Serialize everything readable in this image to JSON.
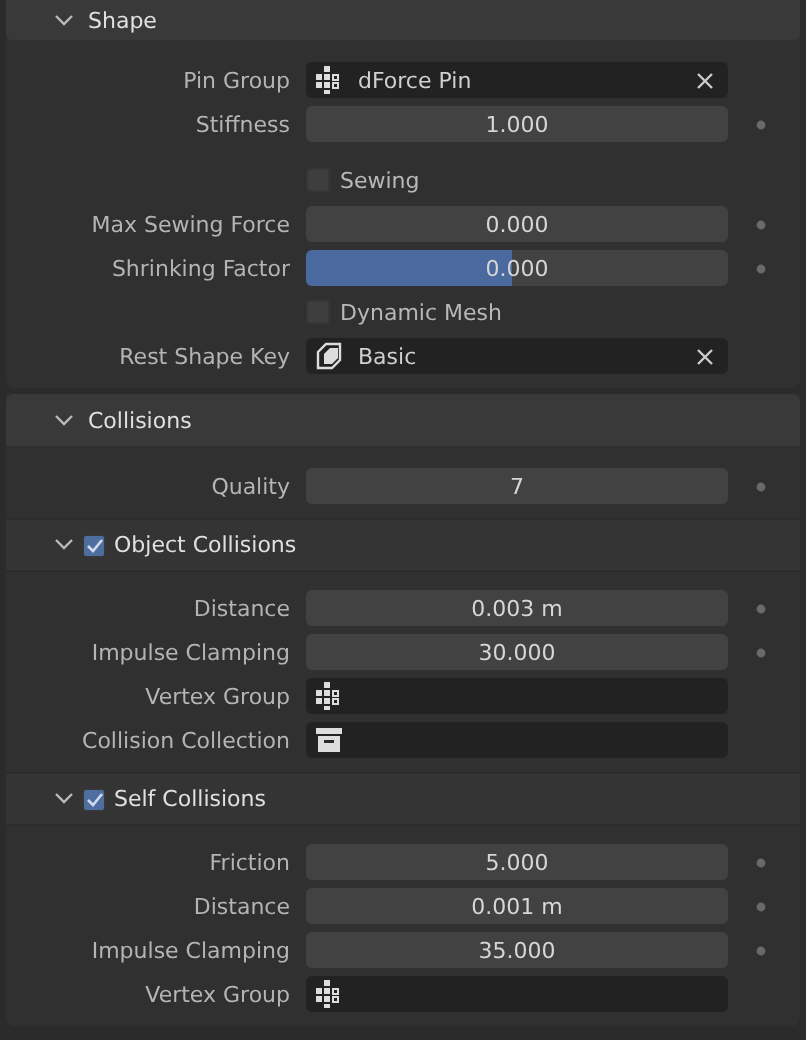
{
  "panels": [
    {
      "title": "Shape",
      "expanded": true,
      "rows": [
        {
          "kind": "vertex_group",
          "label": "Pin Group",
          "value": "dForce Pin"
        },
        {
          "kind": "number",
          "label": "Stiffness",
          "value": "1.000"
        },
        {
          "kind": "spacer"
        },
        {
          "kind": "checkbox",
          "label": "Sewing",
          "checked": false
        },
        {
          "kind": "number",
          "label": "Max Sewing Force",
          "value": "0.000"
        },
        {
          "kind": "slider",
          "label": "Shrinking Factor",
          "value": "0.000",
          "level": 0.49
        },
        {
          "kind": "checkbox",
          "label": "Dynamic Mesh",
          "checked": false
        },
        {
          "kind": "shape_key",
          "label": "Rest Shape Key",
          "value": "Basic"
        }
      ]
    },
    {
      "title": "Collisions",
      "expanded": true,
      "rows": [
        {
          "kind": "number",
          "label": "Quality",
          "value": "7"
        }
      ],
      "subpanels": [
        {
          "title": "Object Collisions",
          "expanded": true,
          "checked": true,
          "rows": [
            {
              "kind": "number",
              "label": "Distance",
              "value": "0.003 m"
            },
            {
              "kind": "number",
              "label": "Impulse Clamping",
              "value": "30.000"
            },
            {
              "kind": "vertex_group",
              "label": "Vertex Group"
            },
            {
              "kind": "collection",
              "label": "Collision Collection"
            }
          ]
        },
        {
          "title": "Self Collisions",
          "expanded": true,
          "checked": true,
          "rows": [
            {
              "kind": "number",
              "label": "Friction",
              "value": "5.000"
            },
            {
              "kind": "number",
              "label": "Distance",
              "value": "0.001 m"
            },
            {
              "kind": "number",
              "label": "Impulse Clamping",
              "value": "35.000"
            },
            {
              "kind": "vertex_group",
              "label": "Vertex Group"
            }
          ]
        }
      ]
    }
  ]
}
